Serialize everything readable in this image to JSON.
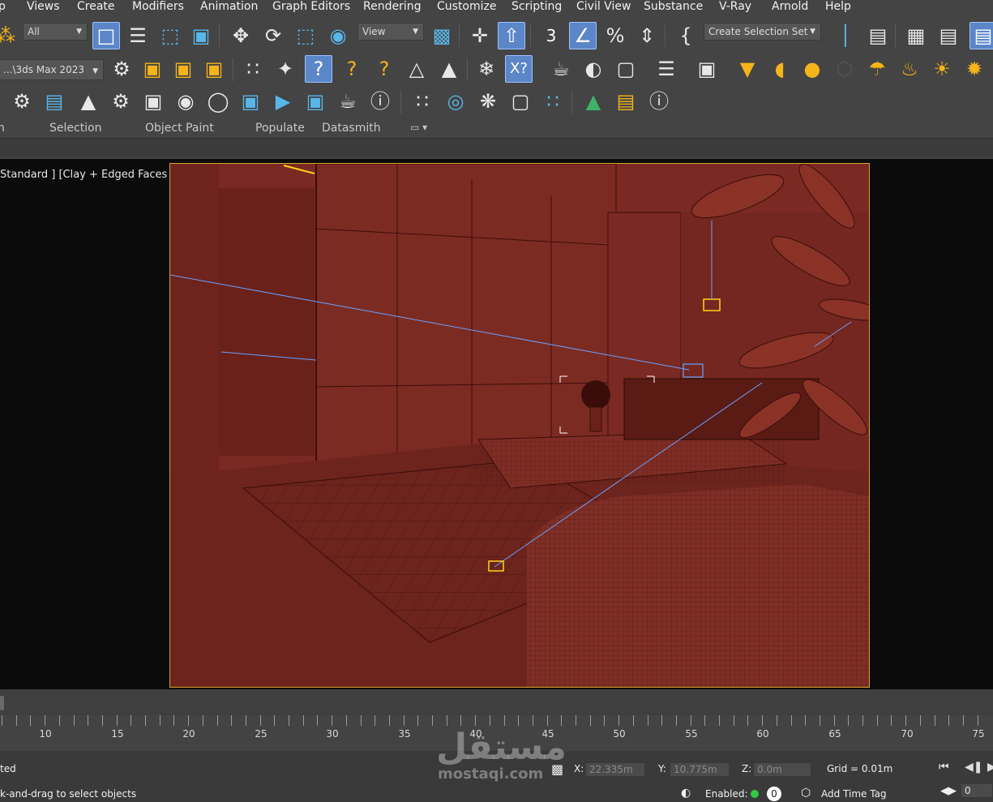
{
  "menubar": {
    "items": [
      "p",
      "Views",
      "Create",
      "Modifiers",
      "Animation",
      "Graph Editors",
      "Rendering",
      "Customize",
      "Scripting",
      "Civil View",
      "Substance",
      "V-Ray",
      "Arnold",
      "Help"
    ]
  },
  "toolbar": {
    "filter_value": "All",
    "refcoord_value": "View",
    "selection_set_value": "Create Selection Set",
    "project_path": "...\\3ds Max 2023"
  },
  "icons": {
    "main": [
      "link-icon",
      "select-object-icon",
      "select-by-name-icon",
      "rect-region-icon",
      "window-crossing-icon",
      "move-icon",
      "rotate-icon",
      "scale-icon",
      "place-icon",
      "pivot-center-icon",
      "snap-3d-icon",
      "angle-snap-icon",
      "percent-snap-icon",
      "spinner-snap-icon",
      "named-selection-icon",
      "mirror-icon",
      "align-icon",
      "scene-explorer-icon",
      "layer-explorer-icon",
      "ribbon-toggle-icon"
    ],
    "row2": [
      "manage-project-icon",
      "materials-icon",
      "slate-icon",
      "render-setup-icon",
      "render-frame-icon",
      "snap-grid-icon",
      "snap-pivot-icon",
      "snap-vertex-icon",
      "snap-edge-icon",
      "snap-face-icon",
      "snap-bbox-icon",
      "snap-perp-icon",
      "freeze-icon",
      "xref-icon",
      "teapot-icon",
      "camera-shot-icon",
      "box-icon",
      "list-icon",
      "camera-icon",
      "spot-light-icon",
      "dome-light-icon",
      "sun-sphere-icon",
      "geodesic-icon",
      "omni-light-icon",
      "flame-light-icon",
      "sun-icon",
      "burst-icon"
    ],
    "row3": [
      "render-cloud-icon",
      "render-list-icon",
      "tree-icon",
      "gear-render-icon",
      "render-material-icon",
      "palette-icon",
      "bulb-icon",
      "vfb-icon",
      "render-view-icon",
      "render-region-icon",
      "teapot-render-icon",
      "help-icon",
      "pivot-points-icon",
      "target-icon",
      "particle-icon",
      "brush-icon",
      "scatter-icon",
      "forest-icon",
      "notes-icon",
      "help-icon-2"
    ]
  },
  "ribbon": {
    "tabs": [
      "n",
      "Selection",
      "Object Paint",
      "Populate",
      "Datasmith"
    ]
  },
  "viewport": {
    "label": "Standard ] [Clay + Edged Faces ]"
  },
  "timeline": {
    "current_frame": "0",
    "labels": [
      "10",
      "15",
      "20",
      "25",
      "30",
      "35",
      "40",
      "45",
      "50",
      "55",
      "60",
      "65",
      "70",
      "75"
    ]
  },
  "status": {
    "selection_text": "ted",
    "prompt_text": "k-and-drag to select objects",
    "x_label": "X:",
    "x_value": "22.335m",
    "y_label": "Y:",
    "y_value": "10.775m",
    "z_label": "Z:",
    "z_value": "0.0m",
    "grid_text": "Grid = 0.01m",
    "enabled_label": "Enabled:",
    "enabled_count": "0",
    "add_time_tag": "Add Time Tag",
    "frame_value": "0"
  },
  "watermark": {
    "arabic": "مستقل",
    "latin": "mostaqi.com"
  },
  "colors": {
    "ui_bg": "#444444",
    "active_button": "#5b86c8",
    "viewport_frame": "#d2a42c",
    "clay": "#7a2a22",
    "wire": "#3a0d0a",
    "light_line": "#6aa0ff",
    "helper_yellow": "#ffd21a",
    "status_green": "#2ecc40"
  }
}
